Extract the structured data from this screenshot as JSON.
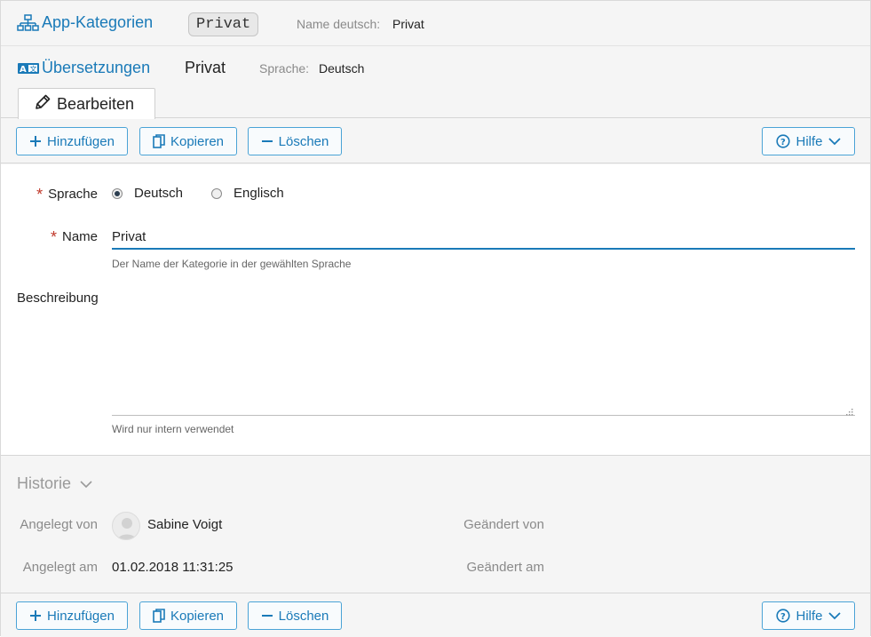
{
  "header": {
    "app_categories_link": "App-Kategorien",
    "record_pill": "Privat",
    "name_de_label": "Name deutsch:",
    "name_de_value": "Privat"
  },
  "translations": {
    "link": "Übersetzungen",
    "title": "Privat",
    "language_label": "Sprache:",
    "language_value": "Deutsch"
  },
  "tab": {
    "edit_label": "Bearbeiten"
  },
  "toolbar": {
    "add_label": "Hinzufügen",
    "copy_label": "Kopieren",
    "delete_label": "Löschen",
    "help_label": "Hilfe"
  },
  "form": {
    "language_label": "Sprache",
    "language_options": [
      "Deutsch",
      "Englisch"
    ],
    "language_selected": "Deutsch",
    "name_label": "Name",
    "name_value": "Privat",
    "name_hint": "Der Name der Kategorie in der gewählten Sprache",
    "description_label": "Beschreibung",
    "description_value": "",
    "description_hint": "Wird nur intern verwendet",
    "required_mark": "*"
  },
  "history": {
    "title": "Historie",
    "created_by_label": "Angelegt von",
    "created_by_value": "Sabine Voigt",
    "changed_by_label": "Geändert von",
    "created_at_label": "Angelegt am",
    "created_at_value": "01.02.2018 11:31:25",
    "changed_at_label": "Geändert am"
  },
  "colors": {
    "accent": "#1a7ab8",
    "required": "#c0392b"
  }
}
